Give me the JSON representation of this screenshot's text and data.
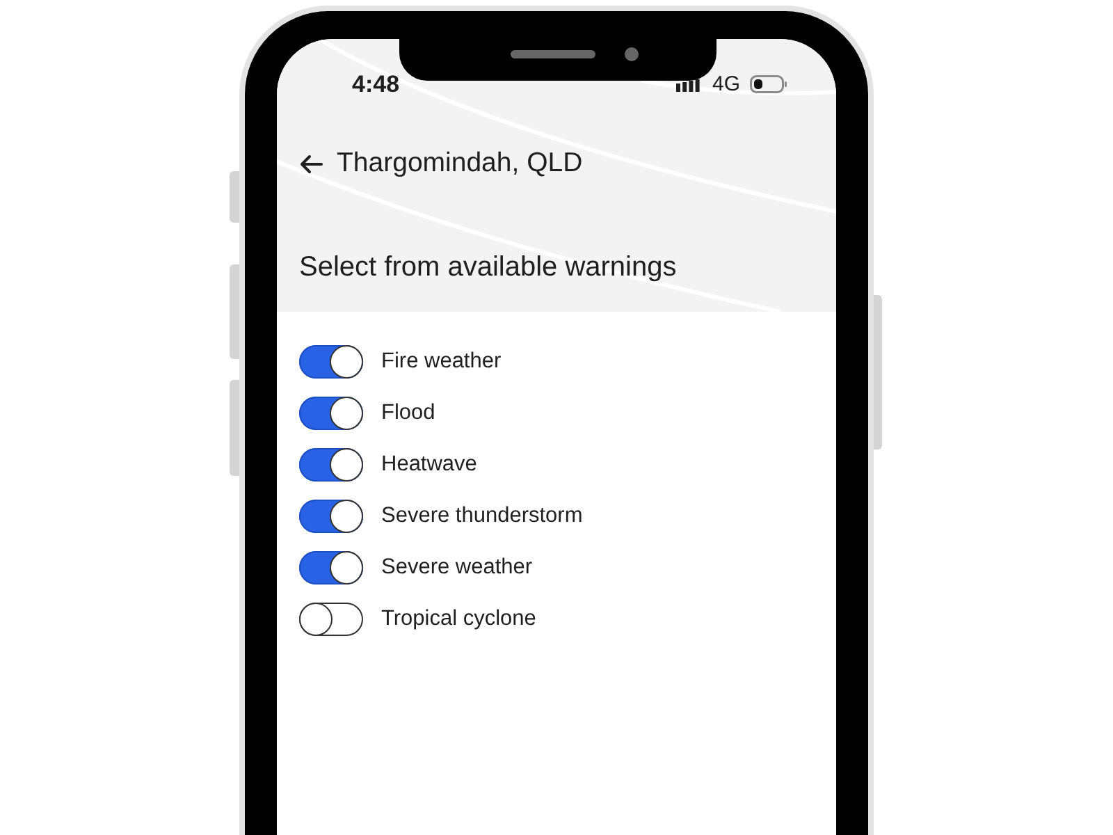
{
  "status_bar": {
    "time": "4:48",
    "network": "4G"
  },
  "header": {
    "title": "Thargomindah, QLD",
    "subtitle": "Select from available warnings"
  },
  "warnings": [
    {
      "label": "Fire weather",
      "on": true
    },
    {
      "label": "Flood",
      "on": true
    },
    {
      "label": "Heatwave",
      "on": true
    },
    {
      "label": "Severe thunderstorm",
      "on": true
    },
    {
      "label": "Severe weather",
      "on": true
    },
    {
      "label": "Tropical cyclone",
      "on": false
    }
  ]
}
